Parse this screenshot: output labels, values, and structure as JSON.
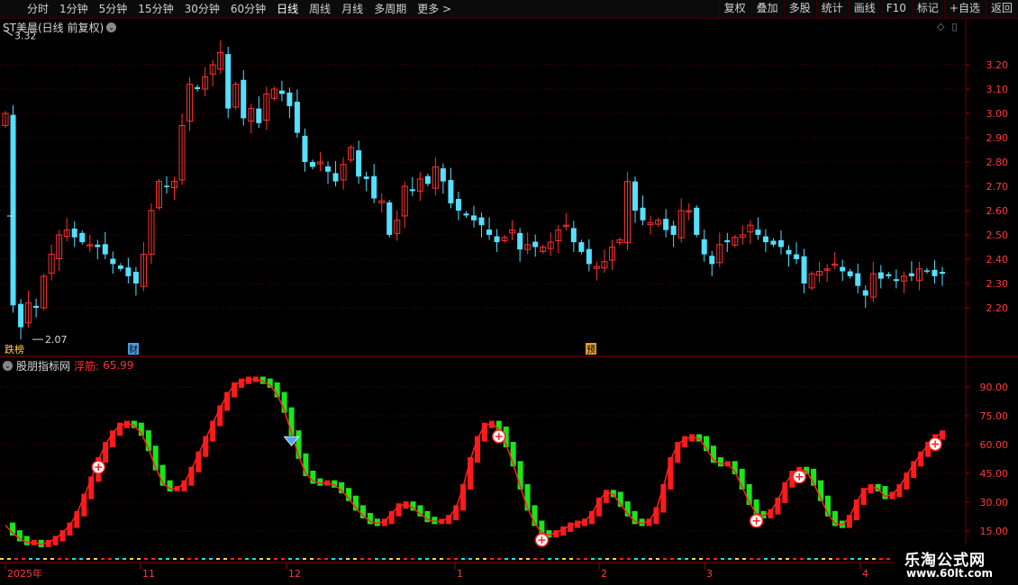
{
  "toolbar": {
    "periods": [
      "分时",
      "1分钟",
      "5分钟",
      "15分钟",
      "30分钟",
      "60分钟",
      "日线",
      "周线",
      "月线",
      "多周期",
      "更多 >"
    ],
    "active_period": "日线",
    "right_buttons": [
      "复权",
      "叠加",
      "多股",
      "统计",
      "画线",
      "F10",
      "标记",
      "+自选",
      "返回"
    ]
  },
  "main_chart": {
    "title": "ST美晨(日线 前复权)",
    "high_marker": "3.32",
    "low_marker": "2.07",
    "y_ticks": [
      "3.20",
      "3.10",
      "3.00",
      "2.90",
      "2.80",
      "2.70",
      "2.60",
      "2.50",
      "2.40",
      "2.30",
      "2.20"
    ],
    "y_range": [
      2.07,
      3.32
    ],
    "event_tags": [
      {
        "label": "财",
        "color": "#4a9fe0"
      },
      {
        "label": "预",
        "color": "#e0a030"
      }
    ],
    "corner_tag": "跌榜",
    "colors": {
      "up": "#ff3030",
      "down": "#54e0ff",
      "grid": "#5a0000"
    }
  },
  "indicator": {
    "source": "股朋指标网",
    "name": "浮筋:",
    "value": "65.99",
    "y_ticks": [
      "90.00",
      "75.00",
      "60.00",
      "45.00",
      "30.00",
      "15.00"
    ],
    "y_range": [
      7,
      98
    ],
    "colors": {
      "up": "#ff1a1a",
      "down": "#19e619",
      "name": "#ff3030"
    }
  },
  "x_axis": {
    "labels": [
      "2025年",
      "11",
      "12",
      "1",
      "2",
      "3",
      "4"
    ]
  },
  "watermark": {
    "line1": "乐淘公式网",
    "line2": "www.60lt.com"
  },
  "chart_data": [
    {
      "type": "candlestick",
      "title": "ST美晨(日线 前复权)",
      "ylim": [
        2.07,
        3.32
      ],
      "x_labels": [
        "2025年",
        "11",
        "12",
        "1",
        "2",
        "3",
        "4"
      ],
      "close": [
        3.0,
        2.21,
        2.12,
        2.22,
        2.2,
        2.33,
        2.42,
        2.5,
        2.52,
        2.49,
        2.47,
        2.46,
        2.45,
        2.42,
        2.38,
        2.36,
        2.33,
        2.3,
        2.42,
        2.6,
        2.72,
        2.7,
        2.72,
        2.95,
        3.12,
        3.1,
        3.15,
        3.2,
        3.25,
        3.02,
        3.12,
        2.98,
        3.02,
        2.96,
        3.08,
        3.1,
        3.08,
        3.03,
        2.92,
        2.8,
        2.78,
        2.8,
        2.76,
        2.72,
        2.79,
        2.86,
        2.74,
        2.73,
        2.65,
        2.64,
        2.5,
        2.56,
        2.7,
        2.68,
        2.73,
        2.71,
        2.78,
        2.72,
        2.63,
        2.6,
        2.58,
        2.56,
        2.54,
        2.5,
        2.47,
        2.49,
        2.52,
        2.44,
        2.46,
        2.45,
        2.45,
        2.47,
        2.52,
        2.54,
        2.47,
        2.43,
        2.38,
        2.37,
        2.39,
        2.45,
        2.48,
        2.72,
        2.6,
        2.56,
        2.55,
        2.56,
        2.52,
        2.5,
        2.6,
        2.6,
        2.5,
        2.42,
        2.38,
        2.46,
        2.47,
        2.49,
        2.5,
        2.54,
        2.5,
        2.47,
        2.46,
        2.45,
        2.42,
        2.4,
        2.3,
        2.34,
        2.35,
        2.36,
        2.38,
        2.35,
        2.33,
        2.29,
        2.25,
        2.34,
        2.32,
        2.33,
        2.31,
        2.33,
        2.33,
        2.36,
        2.35,
        2.33,
        2.34
      ]
    },
    {
      "type": "line",
      "series": [
        {
          "name": "浮筋",
          "values": [
            18,
            14,
            11,
            9,
            9,
            8,
            9,
            11,
            14,
            18,
            24,
            33,
            42,
            52,
            60,
            66,
            70,
            71,
            70,
            66,
            58,
            48,
            40,
            37,
            37,
            40,
            47,
            55,
            63,
            71,
            79,
            86,
            91,
            93,
            94,
            94,
            93,
            91,
            86,
            78,
            66,
            54,
            45,
            41,
            40,
            40,
            39,
            36,
            32,
            27,
            23,
            20,
            19,
            20,
            24,
            28,
            29,
            27,
            24,
            21,
            20,
            20,
            22,
            27,
            38,
            52,
            63,
            70,
            71,
            68,
            60,
            50,
            38,
            27,
            19,
            14,
            13,
            14,
            16,
            18,
            19,
            20,
            24,
            31,
            35,
            34,
            29,
            24,
            20,
            19,
            20,
            26,
            38,
            52,
            60,
            63,
            64,
            63,
            58,
            52,
            50,
            50,
            46,
            38,
            30,
            24,
            23,
            25,
            31,
            39,
            45,
            47,
            46,
            40,
            32,
            24,
            19,
            18,
            22,
            30,
            36,
            38,
            37,
            33,
            34,
            38,
            44,
            50,
            55,
            60,
            64,
            66
          ]
        }
      ],
      "ylim": [
        7,
        98
      ],
      "annotations": [
        "浮筋: 65.99"
      ]
    }
  ]
}
